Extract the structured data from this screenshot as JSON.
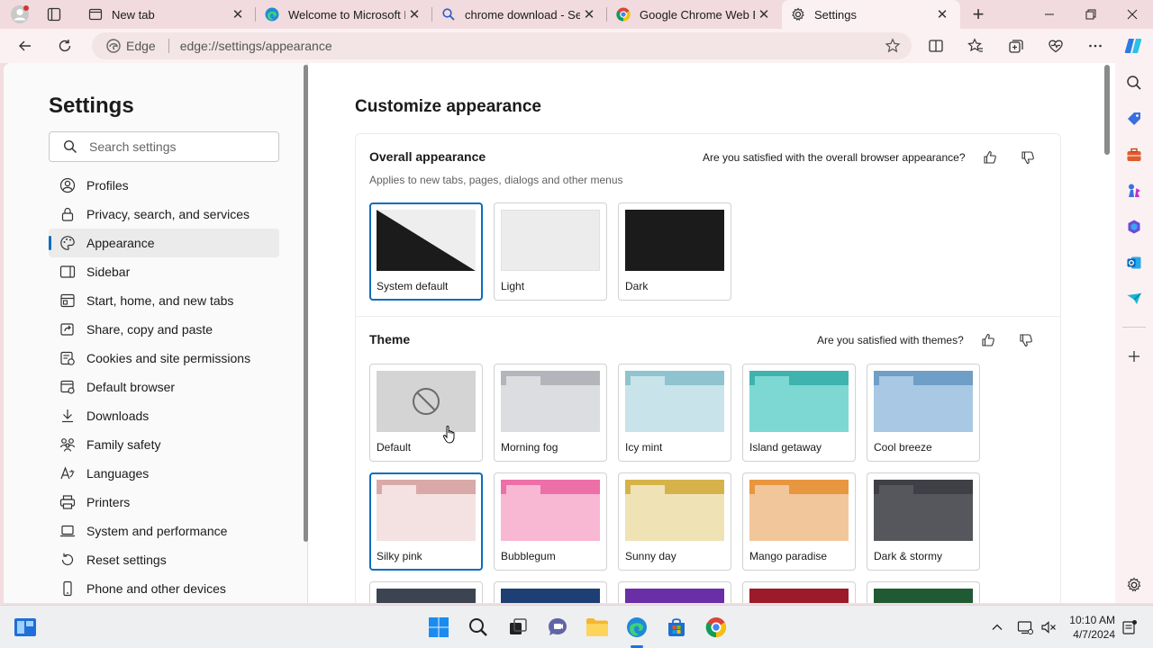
{
  "browser": {
    "tabs": [
      {
        "title": "New tab",
        "icon": "new-tab-icon"
      },
      {
        "title": "Welcome to Microsoft Ed",
        "icon": "edge-logo-icon"
      },
      {
        "title": "chrome download - Sea",
        "icon": "search-icon"
      },
      {
        "title": "Google Chrome Web Br",
        "icon": "chrome-logo-icon"
      },
      {
        "title": "Settings",
        "icon": "gear-icon"
      }
    ],
    "address": {
      "badge": "Edge",
      "url": "edge://settings/appearance"
    }
  },
  "nav": {
    "title": "Settings",
    "search_placeholder": "Search settings",
    "items": [
      {
        "label": "Profiles",
        "icon": "profile-icon"
      },
      {
        "label": "Privacy, search, and services",
        "icon": "lock-icon"
      },
      {
        "label": "Appearance",
        "icon": "palette-icon"
      },
      {
        "label": "Sidebar",
        "icon": "sidebar-icon"
      },
      {
        "label": "Start, home, and new tabs",
        "icon": "home-icon"
      },
      {
        "label": "Share, copy and paste",
        "icon": "share-icon"
      },
      {
        "label": "Cookies and site permissions",
        "icon": "cookie-icon"
      },
      {
        "label": "Default browser",
        "icon": "browser-icon"
      },
      {
        "label": "Downloads",
        "icon": "download-icon"
      },
      {
        "label": "Family safety",
        "icon": "family-icon"
      },
      {
        "label": "Languages",
        "icon": "language-icon"
      },
      {
        "label": "Printers",
        "icon": "printer-icon"
      },
      {
        "label": "System and performance",
        "icon": "laptop-icon"
      },
      {
        "label": "Reset settings",
        "icon": "reset-icon"
      },
      {
        "label": "Phone and other devices",
        "icon": "phone-icon"
      }
    ],
    "selected": "Appearance"
  },
  "main": {
    "title": "Customize appearance",
    "overall": {
      "title": "Overall appearance",
      "subtitle": "Applies to new tabs, pages, dialogs and other menus",
      "feedback": "Are you satisfied with the overall browser appearance?",
      "options": [
        {
          "label": "System default",
          "selected": true
        },
        {
          "label": "Light",
          "selected": false
        },
        {
          "label": "Dark",
          "selected": false
        }
      ]
    },
    "theme": {
      "title": "Theme",
      "feedback": "Are you satisfied with themes?",
      "options": [
        {
          "label": "Default",
          "top": "#d4d4d4",
          "body": "#d4d4d4",
          "selected": false
        },
        {
          "label": "Morning fog",
          "top": "#b3b5bb",
          "body": "#dcdde1",
          "tab": "#dcdde1",
          "selected": false
        },
        {
          "label": "Icy mint",
          "top": "#8fc3cf",
          "body": "#c8e4ea",
          "tab": "#c8e4ea",
          "selected": false
        },
        {
          "label": "Island getaway",
          "top": "#3fb3ae",
          "body": "#7dd8d3",
          "tab": "#7dd8d3",
          "selected": false
        },
        {
          "label": "Cool breeze",
          "top": "#6f9ec6",
          "body": "#a9c8e4",
          "tab": "#a9c8e4",
          "selected": false
        },
        {
          "label": "Silky pink",
          "top": "#d9a9a9",
          "body": "#f4e1e1",
          "tab": "#f4e1e1",
          "selected": true
        },
        {
          "label": "Bubblegum",
          "top": "#ec6fa8",
          "body": "#f8b7d3",
          "tab": "#f8b7d3",
          "selected": false
        },
        {
          "label": "Sunny day",
          "top": "#d6b34a",
          "body": "#efe3b6",
          "tab": "#efe3b6",
          "selected": false
        },
        {
          "label": "Mango paradise",
          "top": "#e8963f",
          "body": "#f2c69b",
          "tab": "#f2c69b",
          "selected": false
        },
        {
          "label": "Dark & stormy",
          "top": "#3f4046",
          "body": "#55575d",
          "tab": "#55575d",
          "selected": false
        },
        {
          "label": "",
          "top": "#3c4452",
          "body": "#2d3440",
          "selected": false
        },
        {
          "label": "",
          "top": "#1d3f73",
          "body": "#132a52",
          "selected": false
        },
        {
          "label": "",
          "top": "#6a2ea6",
          "body": "#4b1f78",
          "selected": false
        },
        {
          "label": "",
          "top": "#9b1b2a",
          "body": "#6f1320",
          "selected": false
        },
        {
          "label": "",
          "top": "#1f5a33",
          "body": "#143f24",
          "selected": false
        }
      ]
    }
  },
  "taskbar": {
    "time": "10:10 AM",
    "date": "4/7/2024"
  },
  "colors": {
    "accent": "#0f6cbd"
  }
}
